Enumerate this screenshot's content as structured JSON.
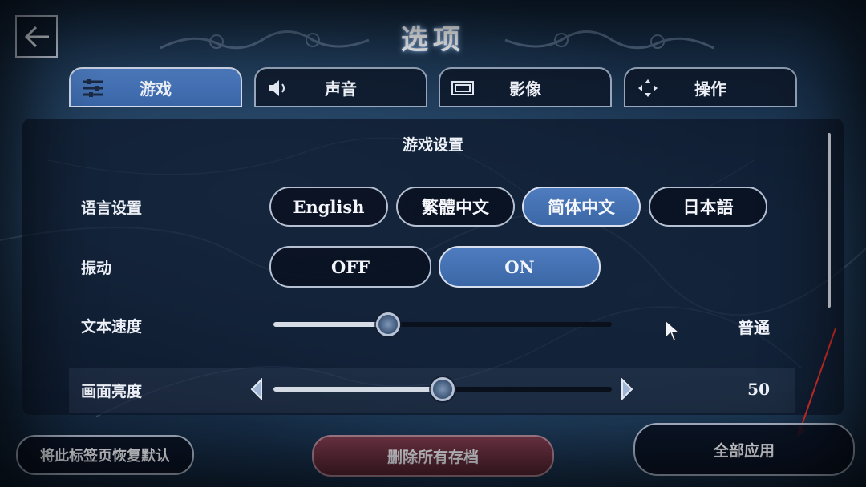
{
  "page": {
    "title": "选项"
  },
  "tabs": [
    {
      "label": "游戏",
      "icon": "sliders-icon",
      "active": true
    },
    {
      "label": "声音",
      "icon": "speaker-icon",
      "active": false
    },
    {
      "label": "影像",
      "icon": "film-icon",
      "active": false
    },
    {
      "label": "操作",
      "icon": "dpad-icon",
      "active": false
    }
  ],
  "panel": {
    "title": "游戏设置",
    "language": {
      "label": "语言设置",
      "options": [
        "English",
        "繁體中文",
        "简体中文",
        "日本語"
      ],
      "selected": "简体中文"
    },
    "vibration": {
      "label": "振动",
      "options": [
        "OFF",
        "ON"
      ],
      "selected": "ON"
    },
    "text_speed": {
      "label": "文本速度",
      "value_label": "普通",
      "fill_fraction": 0.34
    },
    "brightness": {
      "label": "画面亮度",
      "value": "50",
      "fill_fraction": 0.5
    }
  },
  "footer": {
    "reset_label": "将此标签页恢复默认",
    "delete_label": "删除所有存档",
    "apply_label": "全部应用"
  },
  "colors": {
    "accent": "#4a78bb",
    "danger": "#6e3142",
    "annotation_arrow": "#e0302a"
  }
}
